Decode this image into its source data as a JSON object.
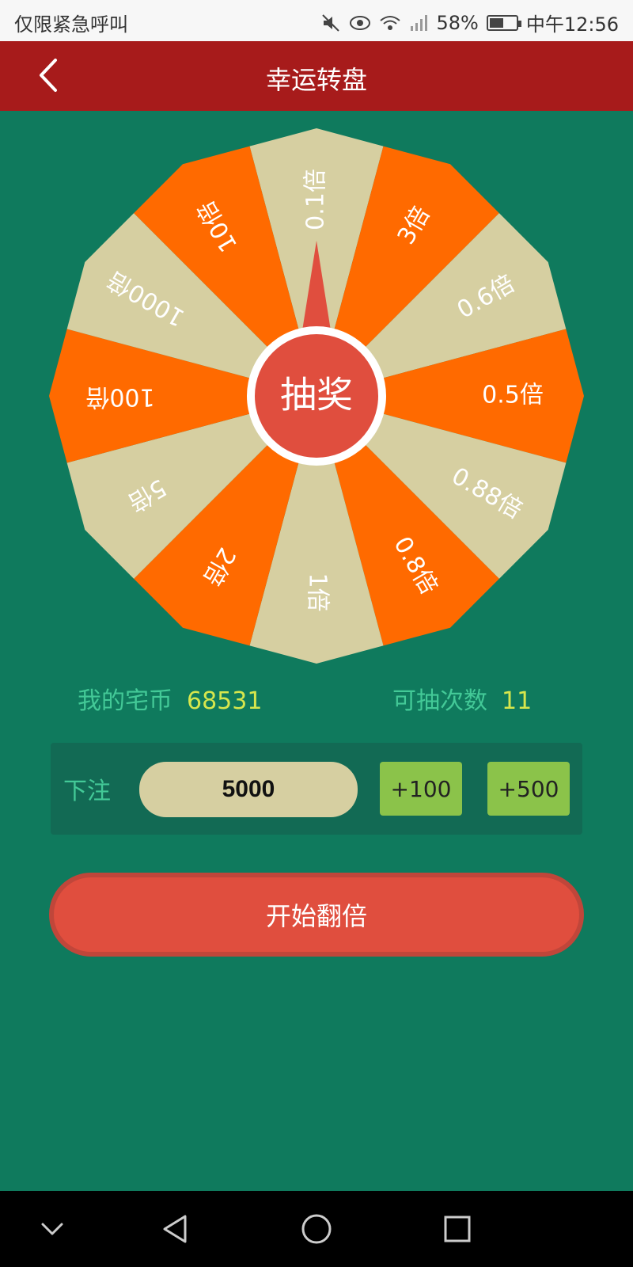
{
  "status_bar": {
    "left_text": "仅限紧急呼叫",
    "battery": "58%",
    "time": "中午12:56",
    "battery_level": 0.58
  },
  "app_bar": {
    "title": "幸运转盘",
    "back_icon": "chevron-left-icon"
  },
  "wheel": {
    "segments": [
      "0.1倍",
      "3倍",
      "0.6倍",
      "0.5倍",
      "0.88倍",
      "0.8倍",
      "1倍",
      "2倍",
      "5倍",
      "100倍",
      "1000倍",
      "10倍"
    ],
    "colors": [
      "#d6cfa1",
      "#ff6a00"
    ],
    "center_label": "抽奖",
    "center_color": "#e04e3e"
  },
  "stats": {
    "coins_label": "我的宅币",
    "coins_value": "68531",
    "draws_label": "可抽次数",
    "draws_value": "11"
  },
  "bet": {
    "label": "下注",
    "value": "5000",
    "add_100": "+100",
    "add_500": "+500"
  },
  "start_button": "开始翻倍",
  "nav_bar": {
    "icons": [
      "chevron-down-icon",
      "back-triangle-icon",
      "home-circle-icon",
      "recents-square-icon"
    ]
  }
}
